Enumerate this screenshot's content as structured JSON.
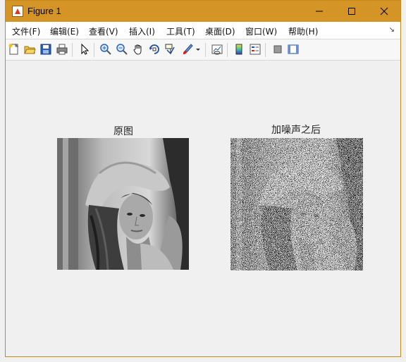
{
  "window": {
    "title": "Figure 1",
    "accent_color": "#d49526"
  },
  "menubar": {
    "items": [
      "文件(F)",
      "编辑(E)",
      "查看(V)",
      "插入(I)",
      "工具(T)",
      "桌面(D)",
      "窗口(W)",
      "帮助(H)"
    ]
  },
  "toolbar": {
    "buttons": [
      "new-figure-icon",
      "open-file-icon",
      "save-icon",
      "print-icon",
      "pointer-icon",
      "zoom-in-icon",
      "zoom-out-icon",
      "pan-hand-icon",
      "rotate-3d-icon",
      "data-cursor-icon",
      "brush-icon",
      "brush-dropdown-icon",
      "link-plot-icon",
      "colorbar-icon",
      "legend-icon",
      "hide-plot-tools-icon",
      "show-plot-tools-icon"
    ]
  },
  "plots": [
    {
      "title": "原图",
      "image": "grayscale-portrait-original"
    },
    {
      "title": "加噪声之后",
      "image": "grayscale-portrait-salt-pepper-noise"
    }
  ]
}
